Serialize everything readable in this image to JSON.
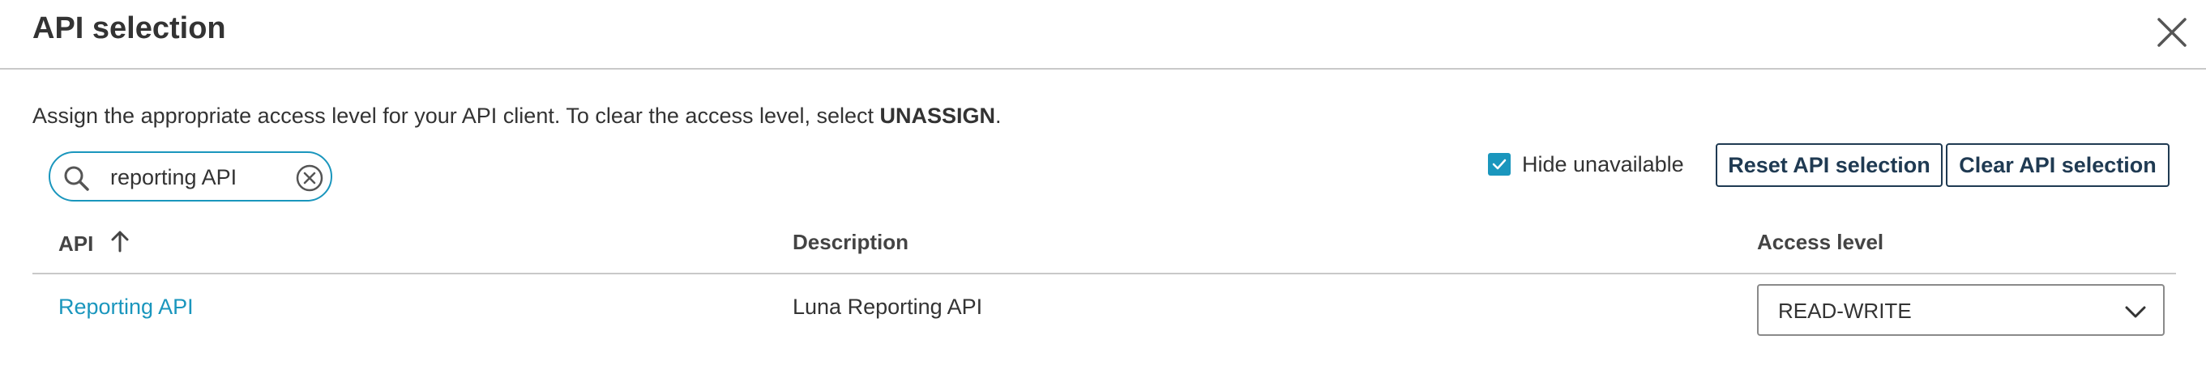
{
  "dialog": {
    "title": "API selection",
    "close_icon": "close-icon"
  },
  "instructions": {
    "text_before": "Assign the appropriate access level for your API client. To clear the access level, select ",
    "bold": "UNASSIGN",
    "text_after": "."
  },
  "search": {
    "value": "reporting API",
    "icon": "search-icon",
    "clear_icon": "clear-circle-icon"
  },
  "filters": {
    "hide_unavailable_label": "Hide unavailable",
    "hide_unavailable_checked": true
  },
  "buttons": {
    "reset": "Reset API selection",
    "clear": "Clear API selection"
  },
  "table": {
    "columns": {
      "api": "API",
      "description": "Description",
      "access": "Access level"
    },
    "sort_icon": "arrow-up-icon",
    "rows": [
      {
        "api": "Reporting API",
        "description": "Luna Reporting API",
        "access": "READ-WRITE"
      }
    ]
  },
  "colors": {
    "accent": "#1a96bd",
    "button_border": "#1f3a52",
    "rule": "#c9c9c9"
  }
}
